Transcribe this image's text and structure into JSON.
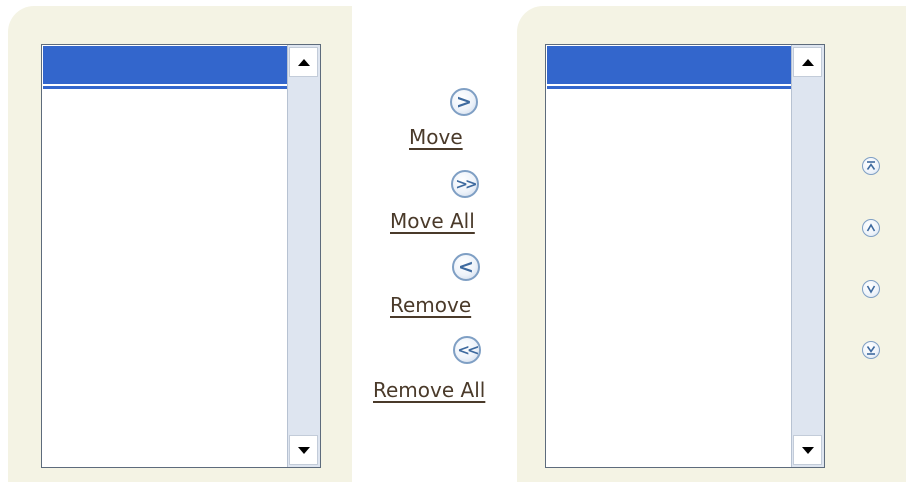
{
  "shuttle": {
    "move_label": "Move",
    "move_all_label": "Move All",
    "remove_label": "Remove",
    "remove_all_label": "Remove All"
  },
  "icons": {
    "move": "chevron-right-icon",
    "move_all": "double-chevron-right-icon",
    "remove": "chevron-left-icon",
    "remove_all": "double-chevron-left-icon",
    "scroll_up": "arrow-up-icon",
    "scroll_down": "arrow-down-icon",
    "move_top": "move-to-top-icon",
    "move_up": "move-up-icon",
    "move_down": "move-down-icon",
    "move_bottom": "move-to-bottom-icon"
  },
  "colors": {
    "panel_bg": "#f4f3e4",
    "selection": "#3366cc",
    "link_text": "#4a3a2a",
    "icon_blue": "#3e6a9f"
  }
}
